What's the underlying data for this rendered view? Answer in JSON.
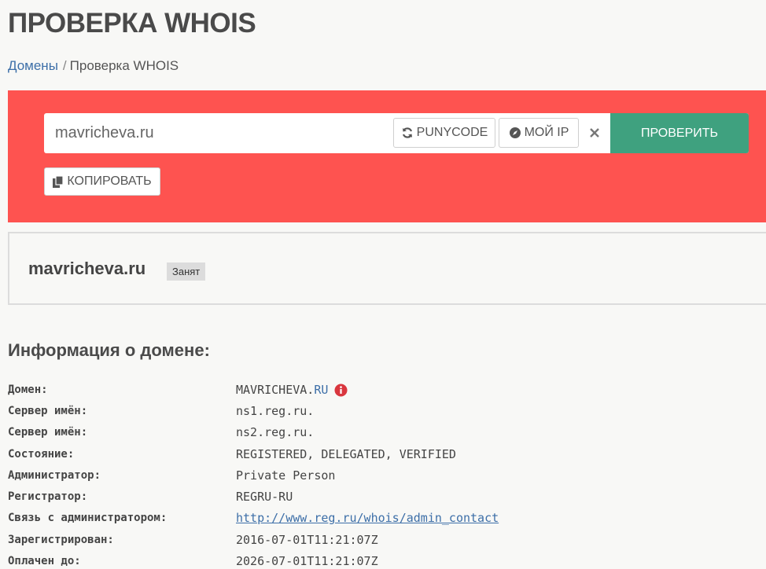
{
  "page": {
    "title": "ПРОВЕРКА WHOIS"
  },
  "breadcrumb": {
    "link": "Домены",
    "separator": "/",
    "current": "Проверка WHOIS"
  },
  "search": {
    "value": "mavricheva.ru",
    "punycode_label": "PUNYCODE",
    "myip_label": "МОЙ IP",
    "check_label": "ПРОВЕРИТЬ",
    "copy_label": "КОПИРОВАТЬ"
  },
  "result": {
    "domain": "mavricheva.ru",
    "status": "Занят"
  },
  "info": {
    "title": "Информация о домене:",
    "rows": [
      {
        "label": "Домен:",
        "value_prefix": "MAVRICHEVA.",
        "value_link": "RU",
        "icon": "info-icon"
      },
      {
        "label": "Сервер имён:",
        "value": "ns1.reg.ru."
      },
      {
        "label": "Сервер имён:",
        "value": "ns2.reg.ru."
      },
      {
        "label": "Состояние:",
        "value": "REGISTERED, DELEGATED, VERIFIED"
      },
      {
        "label": "Администратор:",
        "value": "Private Person"
      },
      {
        "label": "Регистратор:",
        "value": "REGRU-RU"
      },
      {
        "label": "Связь с администратором:",
        "value": "http://www.reg.ru/whois/admin_contact",
        "is_link": true
      },
      {
        "label": "Зарегистрирован:",
        "value": "2016-07-01T11:21:07Z"
      },
      {
        "label": "Оплачен до:",
        "value": "2026-07-01T11:21:07Z"
      }
    ]
  },
  "colors": {
    "panel": "#fe5350",
    "check_button": "#3fa17f",
    "link": "#3d6fa8",
    "info_icon": "#d9363e"
  }
}
